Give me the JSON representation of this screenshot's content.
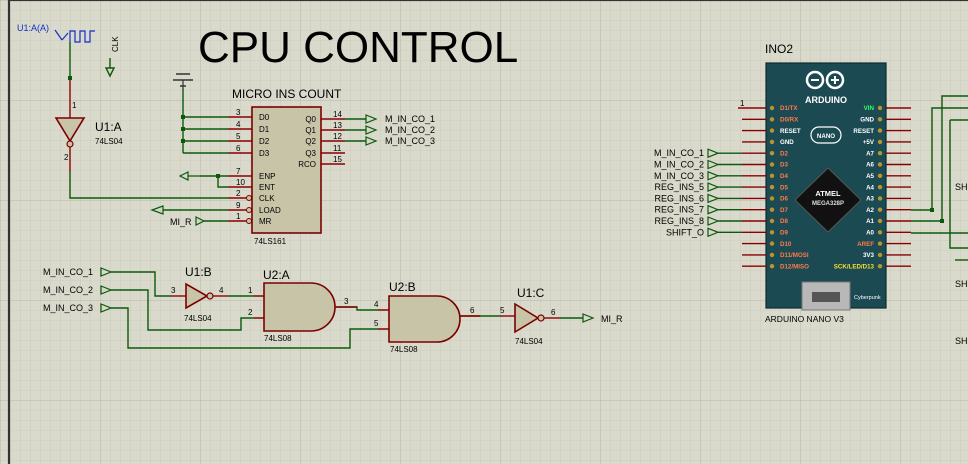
{
  "title": "CPU CONTROL",
  "clock_probe": "U1:A(A)",
  "clk_label": "CLK",
  "counter": {
    "name": "MICRO INS COUNT",
    "part": "74LS161",
    "pins_left": [
      {
        "num": "3",
        "name": "D0"
      },
      {
        "num": "4",
        "name": "D1"
      },
      {
        "num": "5",
        "name": "D2"
      },
      {
        "num": "6",
        "name": "D3"
      },
      {
        "num": "7",
        "name": "ENP"
      },
      {
        "num": "10",
        "name": "ENT"
      },
      {
        "num": "2",
        "name": "CLK"
      },
      {
        "num": "9",
        "name": "LOAD"
      },
      {
        "num": "1",
        "name": "MR"
      }
    ],
    "pins_right": [
      {
        "num": "14",
        "name": "Q0"
      },
      {
        "num": "13",
        "name": "Q1"
      },
      {
        "num": "12",
        "name": "Q2"
      },
      {
        "num": "11",
        "name": "Q3"
      },
      {
        "num": "15",
        "name": "RCO"
      }
    ]
  },
  "terminals": {
    "q_outputs": [
      "M_IN_CO_1",
      "M_IN_CO_2",
      "M_IN_CO_3"
    ],
    "mr_input": "MI_R",
    "gate_inputs": [
      "M_IN_CO_1",
      "M_IN_CO_2",
      "M_IN_CO_3"
    ],
    "gate_output": "MI_R",
    "arduino_inputs": [
      "M_IN_CO_1",
      "M_IN_CO_2",
      "M_IN_CO_3",
      "REG_INS_5",
      "REG_INS_6",
      "REG_INS_7",
      "REG_INS_8",
      "SHIFT_O"
    ]
  },
  "gates": {
    "u1a": {
      "ref": "U1:A",
      "part": "74LS04",
      "in": "1",
      "out": "2"
    },
    "u1b": {
      "ref": "U1:B",
      "part": "74LS04",
      "in": "3",
      "out": "4"
    },
    "u2a": {
      "ref": "U2:A",
      "part": "74LS08",
      "in1": "1",
      "in2": "2",
      "out": "3"
    },
    "u2b": {
      "ref": "U2:B",
      "part": "74LS08",
      "in1": "4",
      "in2": "5",
      "out": "6"
    },
    "u1c": {
      "ref": "U1:C",
      "part": "74LS04",
      "in": "5",
      "out": "6"
    }
  },
  "arduino": {
    "ref": "INO2",
    "model": "ARDUINO NANO V3",
    "brand": "ARDUINO",
    "nano": "NANO",
    "chip1": "ATMEL",
    "chip2": "MEGA328P",
    "maker": "Cyberpunk",
    "left_pins": [
      "D1/TX",
      "D0/RX",
      "RESET",
      "GND",
      "D2",
      "D3",
      "D4",
      "D5",
      "D6",
      "D7",
      "D8",
      "D9",
      "D10",
      "D11/MOSI",
      "D12/MISO"
    ],
    "right_pins": [
      "VIN",
      "GND",
      "RESET",
      "+5V",
      "A7",
      "A6",
      "A5",
      "A4",
      "A3",
      "A2",
      "A1",
      "A0",
      "AREF",
      "3V3",
      "SCK/LED/D13"
    ],
    "pin1": "1"
  },
  "right_edge_labels": [
    "SH",
    "SH",
    "SH"
  ],
  "colors": {
    "wire": "#0b5a0b",
    "pin": "#8a0000",
    "board": "#1c4a52",
    "body": "#c8c4a8"
  }
}
